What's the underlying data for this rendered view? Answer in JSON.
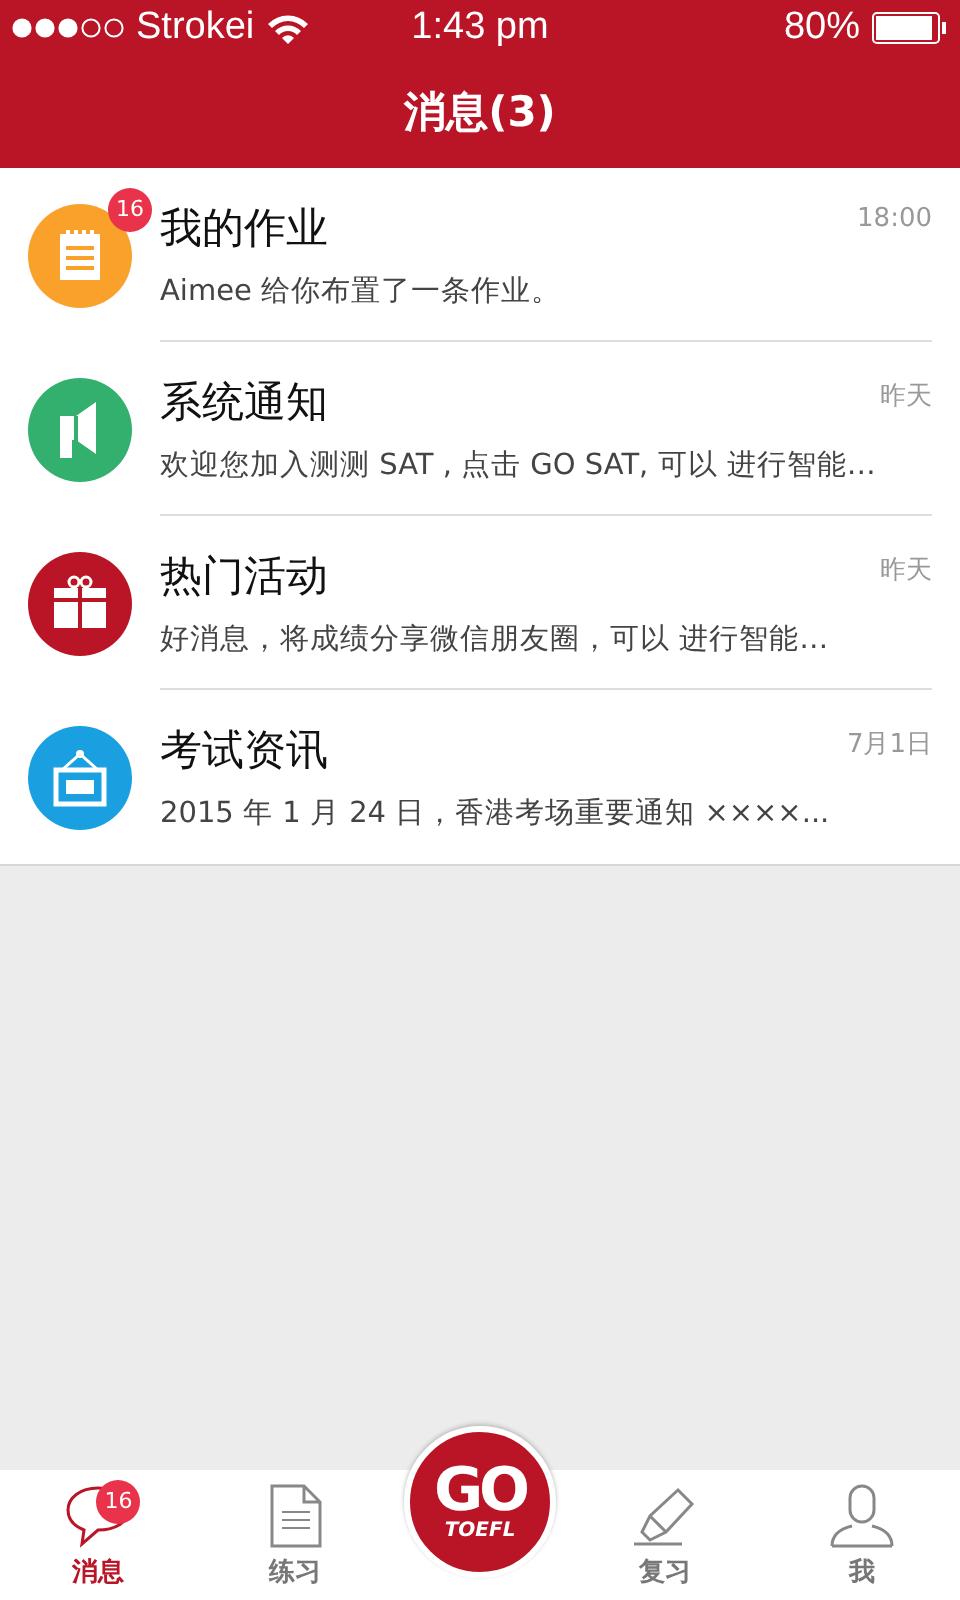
{
  "status_bar": {
    "carrier": "Strokei",
    "time": "1:43 pm",
    "battery": "80%"
  },
  "header": {
    "title": "消息(3)"
  },
  "messages": [
    {
      "kind": "homework",
      "color": "#f9a12a",
      "badge": "16",
      "title": "我的作业",
      "time": "18:00",
      "preview": "Aimee 给你布置了一条作业。"
    },
    {
      "kind": "notice",
      "color": "#33b06d",
      "title": "系统通知",
      "time": "昨天",
      "preview": "欢迎您加入测测 SAT , 点击 GO SAT, 可以 进行智能…"
    },
    {
      "kind": "event",
      "color": "#b91527",
      "title": "热门活动",
      "time": "昨天",
      "preview": "好消息，将成绩分享微信朋友圈，可以 进行智能…"
    },
    {
      "kind": "news",
      "color": "#1aa0e0",
      "title": "考试资讯",
      "time": "7月1日",
      "preview": "2015 年 1 月 24 日，香港考场重要通知 ××××..."
    }
  ],
  "tab_bar": {
    "tabs": [
      {
        "kind": "chat",
        "label": "消息",
        "badge": "16",
        "selected": true
      },
      {
        "kind": "doc",
        "label": "练习",
        "selected": false
      },
      {
        "kind": "go",
        "label": "GO",
        "sublabel": "TOEFL",
        "selected": false
      },
      {
        "kind": "pen",
        "label": "复习",
        "selected": false
      },
      {
        "kind": "user",
        "label": "我",
        "selected": false
      }
    ]
  }
}
